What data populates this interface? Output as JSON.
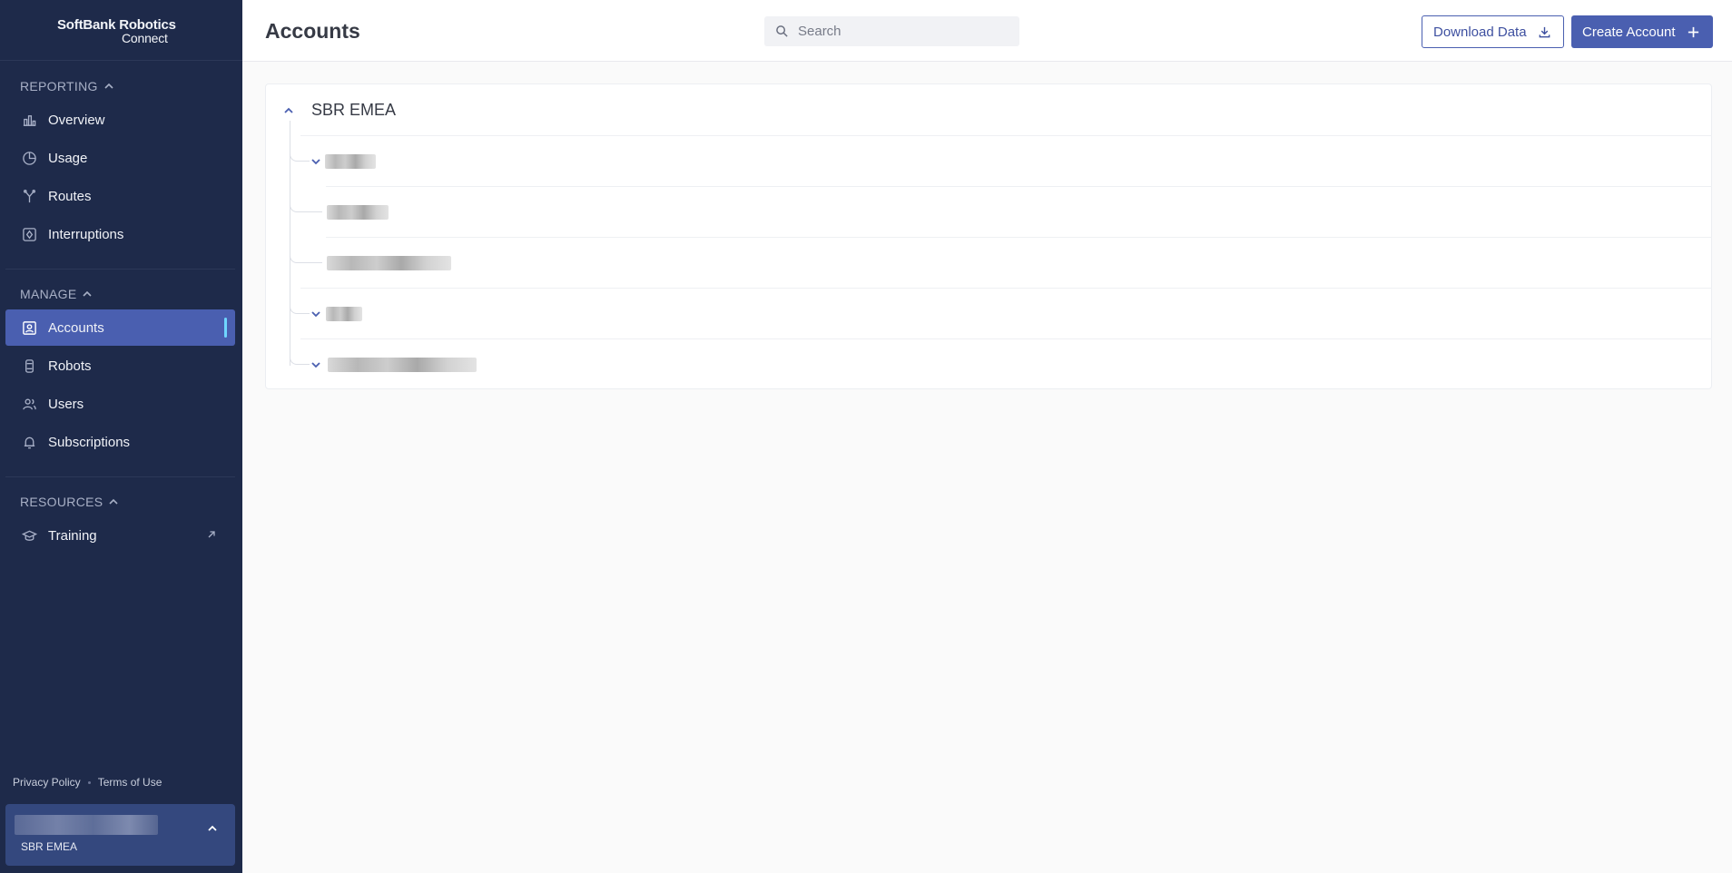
{
  "app": {
    "logo_line1": "SoftBank Robotics",
    "logo_line2": "Connect"
  },
  "sidebar": {
    "sections": [
      {
        "title": "REPORTING",
        "items": [
          {
            "label": "Overview",
            "icon": "bar-chart-icon"
          },
          {
            "label": "Usage",
            "icon": "pie-chart-icon"
          },
          {
            "label": "Routes",
            "icon": "route-icon"
          },
          {
            "label": "Interruptions",
            "icon": "interruption-icon"
          }
        ]
      },
      {
        "title": "MANAGE",
        "items": [
          {
            "label": "Accounts",
            "icon": "account-icon",
            "active": true
          },
          {
            "label": "Robots",
            "icon": "robot-icon"
          },
          {
            "label": "Users",
            "icon": "users-icon"
          },
          {
            "label": "Subscriptions",
            "icon": "bell-icon"
          }
        ]
      },
      {
        "title": "RESOURCES",
        "items": [
          {
            "label": "Training",
            "icon": "graduation-cap-icon",
            "external": true
          }
        ]
      }
    ],
    "footer": {
      "privacy": "Privacy Policy",
      "terms": "Terms of Use"
    },
    "account_switcher": {
      "account": "SBR EMEA"
    }
  },
  "header": {
    "title": "Accounts",
    "search_placeholder": "Search",
    "download_label": "Download Data",
    "create_label": "Create Account"
  },
  "tree": {
    "root": "SBR EMEA"
  },
  "colors": {
    "sidebar_bg": "#1e2a4a",
    "accent": "#4a5fb0",
    "active_indicator": "#6fd6ff"
  }
}
